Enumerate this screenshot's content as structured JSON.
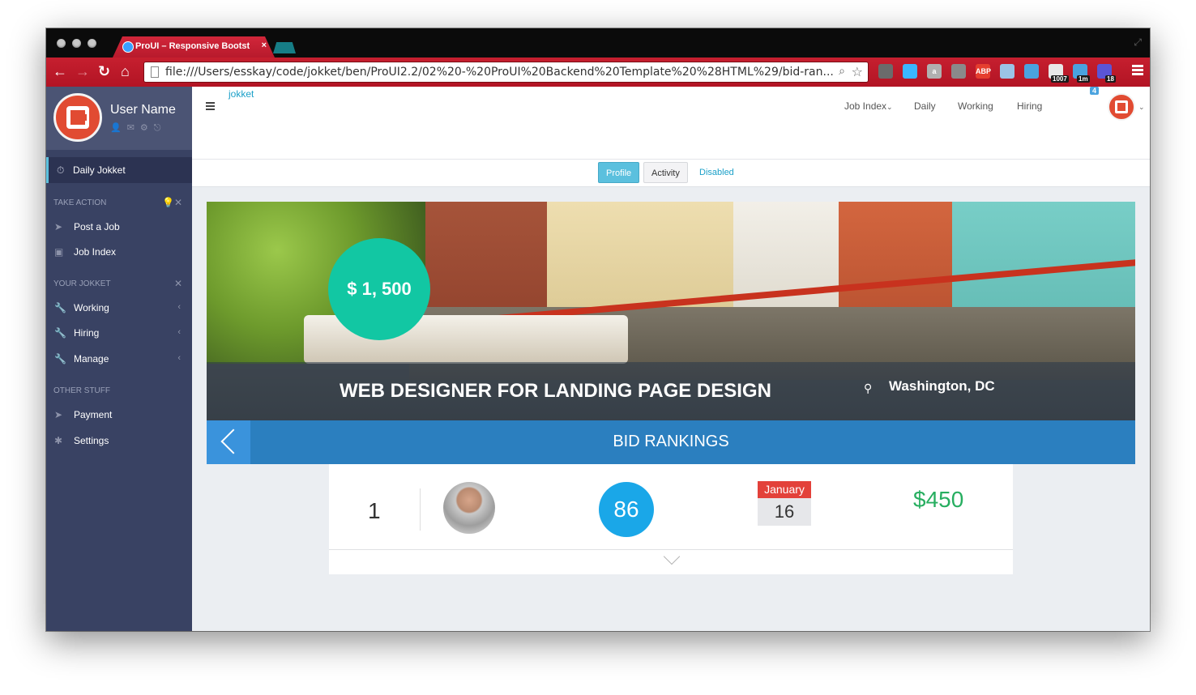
{
  "browser": {
    "tab_title": "ProUI – Responsive Bootst",
    "url": "file:///Users/esskay/code/jokket/ben/ProUI2.2/02%20-%20ProUI%20Backend%20Template%20%28HTML%29/bid-ran...",
    "extensions": [
      {
        "name": "evernote-icon",
        "color": "#6b6b6b",
        "label": ""
      },
      {
        "name": "pocket-icon",
        "color": "#3ab7ff",
        "label": ""
      },
      {
        "name": "amazon-icon",
        "color": "#b0b0b0",
        "label": "a"
      },
      {
        "name": "sound-icon",
        "color": "#8a8a8a",
        "label": ""
      },
      {
        "name": "adblock-icon",
        "color": "#e53e2f",
        "label": "ABP"
      },
      {
        "name": "screen-icon",
        "color": "#9bc3e6",
        "label": ""
      },
      {
        "name": "clock-icon",
        "color": "#4aa3df",
        "label": ""
      },
      {
        "name": "gmail-icon",
        "color": "#e8e8e8",
        "label": ""
      },
      {
        "name": "tweet-icon",
        "color": "#4aa3df",
        "label": ""
      },
      {
        "name": "feed-icon",
        "color": "#5a55d6",
        "label": ""
      }
    ],
    "badges": [
      "1007",
      "1m",
      "18"
    ]
  },
  "sidebar": {
    "user_name": "User Name",
    "active_item": "Daily Jokket",
    "sections": [
      {
        "header": "TAKE ACTION",
        "items": [
          {
            "label": "Post a Job",
            "icon": "paper-plane-icon",
            "caret": false
          },
          {
            "label": "Job Index",
            "icon": "briefcase-icon",
            "caret": false
          }
        ]
      },
      {
        "header": "YOUR JOKKET",
        "items": [
          {
            "label": "Working",
            "icon": "wrench-icon",
            "caret": true
          },
          {
            "label": "Hiring",
            "icon": "wrench-icon",
            "caret": true
          },
          {
            "label": "Manage",
            "icon": "wrench-icon",
            "caret": true
          }
        ]
      },
      {
        "header": "OTHER STUFF",
        "items": [
          {
            "label": "Payment",
            "icon": "paper-plane-icon",
            "caret": false
          },
          {
            "label": "Settings",
            "icon": "asterisk-icon",
            "caret": false
          }
        ]
      }
    ]
  },
  "topnav": {
    "brand": "jokket",
    "links": [
      "Job Index",
      "Daily",
      "Working",
      "Hiring"
    ],
    "notification_count": "4"
  },
  "tabs": {
    "active": "Profile",
    "default": "Activity",
    "disabled": "Disabled"
  },
  "job": {
    "price": "$ 1, 500",
    "title": "WEB DESIGNER FOR LANDING PAGE DESIGN",
    "location": "Washington, DC"
  },
  "rankings": {
    "title": "BID RANKINGS",
    "bids": [
      {
        "rank": "1",
        "score": "86",
        "month": "January",
        "day": "16",
        "amount": "$450"
      }
    ]
  },
  "colors": {
    "sidebar": "#394263",
    "accent": "#5bc0de",
    "price_circle": "#12c7a3",
    "rank_bar": "#2b7fbf",
    "score": "#1aa7e8",
    "amount": "#27ae60"
  }
}
